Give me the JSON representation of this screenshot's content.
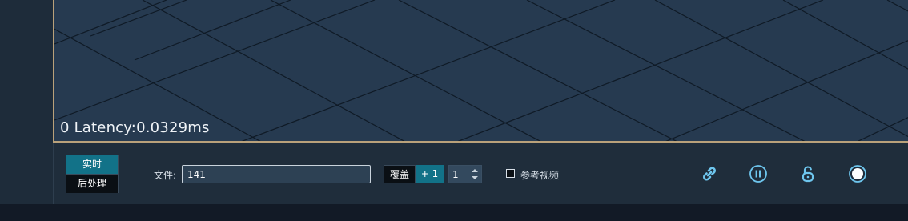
{
  "viewport": {
    "latency_text": "0 Latency:0.0329ms"
  },
  "toolbar": {
    "modes": [
      {
        "label": "实时",
        "active": true
      },
      {
        "label": "后处理",
        "active": false
      }
    ],
    "file_label": "文件:",
    "file_value": "141",
    "overlay_label": "覆盖",
    "plus_label": "+ 1",
    "spinner_value": "1",
    "reference_video_label": "参考视频",
    "reference_video_checked": false,
    "icons": [
      "link-icon",
      "pause-icon",
      "unlock-icon",
      "record-icon"
    ]
  },
  "colors": {
    "accent": "#127288",
    "icon": "#6ec6ee",
    "viewport_border": "#b9a17a"
  }
}
